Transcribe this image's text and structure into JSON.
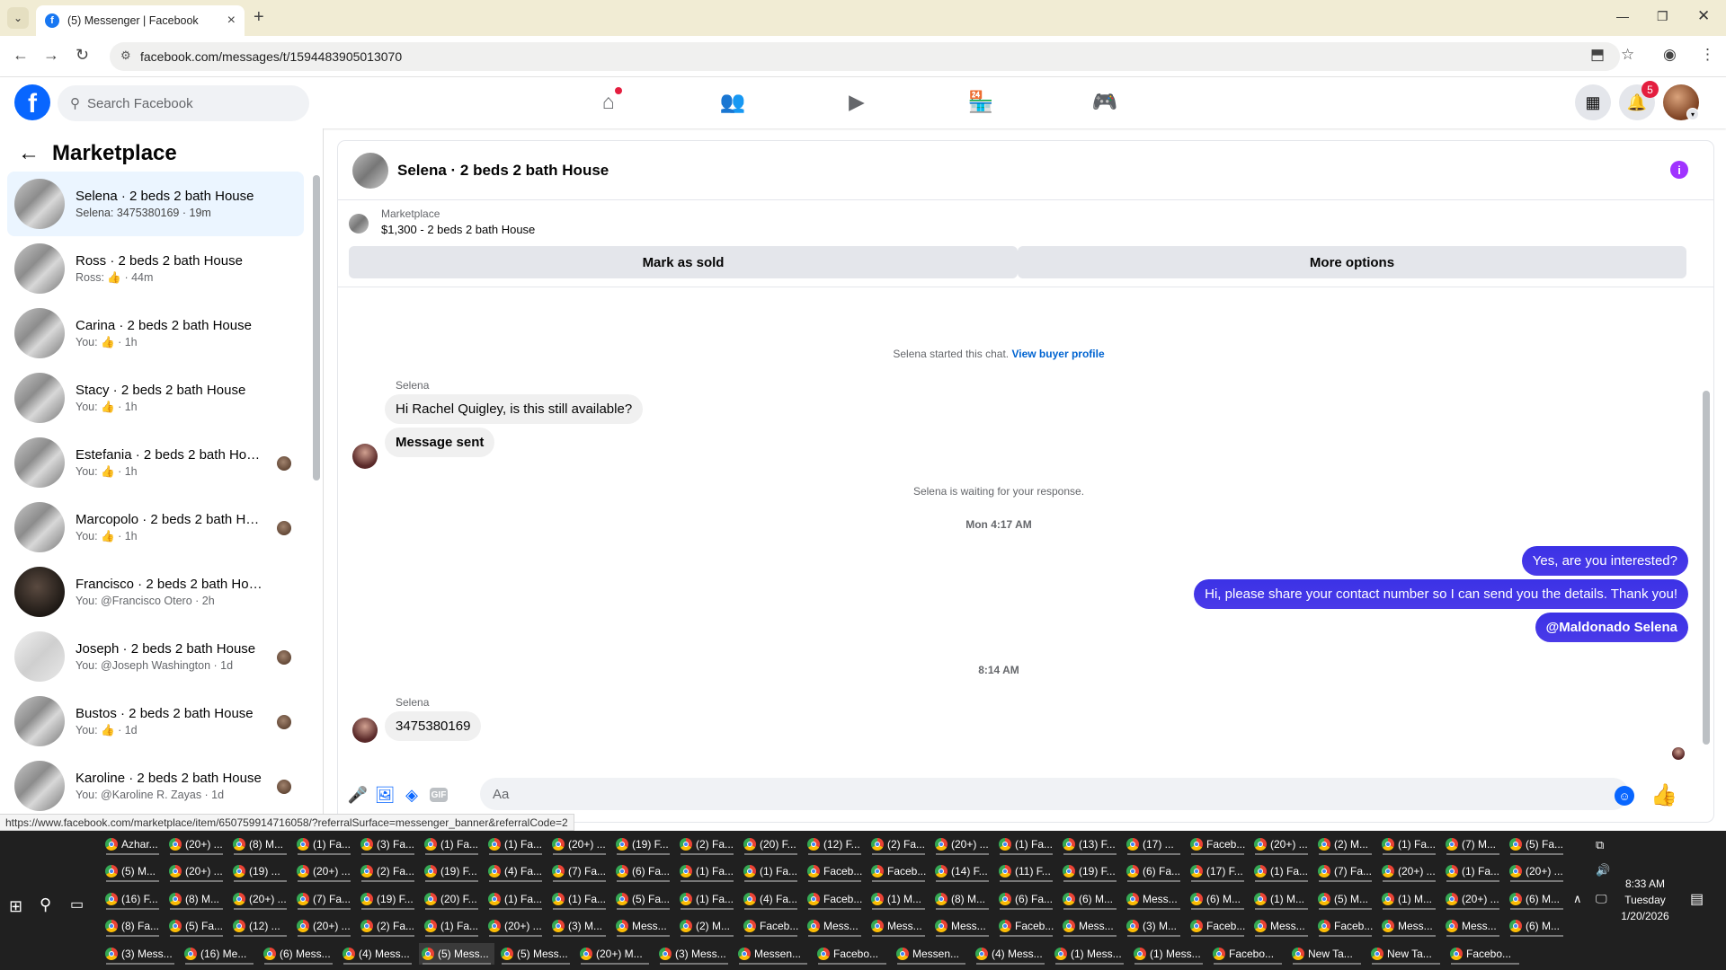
{
  "browser": {
    "tab_title": "(5) Messenger | Facebook",
    "url": "facebook.com/messages/t/1594483905013070",
    "status_url": "https://www.facebook.com/marketplace/item/650759914716058/?referralSurface=messenger_banner&referralCode=2"
  },
  "fb_header": {
    "search_placeholder": "Search Facebook",
    "notification_count": "5",
    "nav_icons": [
      "home-icon",
      "friends-icon",
      "watch-icon",
      "marketplace-icon",
      "gaming-icon"
    ]
  },
  "sidebar": {
    "title": "Marketplace",
    "conversations": [
      {
        "name": "Selena · 2 beds 2 bath House",
        "preview": "Selena: 3475380169 · 19m"
      },
      {
        "name": "Ross · 2 beds 2 bath House",
        "preview": "Ross: 👍 · 44m"
      },
      {
        "name": "Carina · 2 beds 2 bath House",
        "preview": "You: 👍 · 1h"
      },
      {
        "name": "Stacy · 2 beds 2 bath House",
        "preview": "You: 👍 · 1h"
      },
      {
        "name": "Estefania · 2 beds 2 bath House",
        "preview": "You: 👍 · 1h"
      },
      {
        "name": "Marcopolo · 2 beds 2 bath Ho...",
        "preview": "You: 👍 · 1h"
      },
      {
        "name": "Francisco · 2 beds 2 bath House",
        "preview": "You: @Francisco Otero · 2h"
      },
      {
        "name": "Joseph · 2 beds 2 bath House",
        "preview": "You: @Joseph Washington · 1d"
      },
      {
        "name": "Bustos · 2 beds 2 bath House",
        "preview": "You: 👍 · 1d"
      },
      {
        "name": "Karoline · 2 beds 2 bath House",
        "preview": "You: @Karoline R. Zayas · 1d"
      }
    ]
  },
  "chat": {
    "title": "Selena · 2 beds 2 bath House",
    "banner_label": "Marketplace",
    "banner_price": "$1,300 - 2 beds 2 bath House",
    "mark_sold": "Mark as sold",
    "more_options": "More options",
    "started_text": "Selena started this chat.",
    "view_profile": "View buyer profile",
    "sender_name": "Selena",
    "msg_in_1": "Hi Rachel Quigley, is this still available?",
    "msg_in_2": "Message sent",
    "waiting_text": "Selena is waiting for your response.",
    "time_1": "Mon 4:17 AM",
    "msg_out_1": "Yes, are you interested?",
    "msg_out_2": "Hi, please share your contact number so I can send you the details. Thank you!",
    "msg_out_3": "@Maldonado Selena",
    "time_2": "8:14 AM",
    "msg_in_3": "3475380169",
    "input_placeholder": "Aa"
  },
  "taskbar": {
    "rows": [
      [
        "Azhar...",
        "(20+) ...",
        "(8) M...",
        "(1) Fa...",
        "(3) Fa...",
        "(1) Fa...",
        "(1) Fa...",
        "(20+) ...",
        "(19) F...",
        "(2) Fa...",
        "(20) F...",
        "(12) F...",
        "(2) Fa...",
        "(20+) ...",
        "(1) Fa...",
        "(13) F...",
        "(17) ...",
        "Faceb...",
        "(20+) ...",
        "(2) M...",
        "(1) Fa...",
        "(7) M...",
        "(5) Fa..."
      ],
      [
        "(5) M...",
        "(20+) ...",
        "(19) ...",
        "(20+) ...",
        "(2) Fa...",
        "(19) F...",
        "(4) Fa...",
        "(7) Fa...",
        "(6) Fa...",
        "(1) Fa...",
        "(1) Fa...",
        "Faceb...",
        "Faceb...",
        "(14) F...",
        "(11) F...",
        "(19) F...",
        "(6) Fa...",
        "(17) F...",
        "(1) Fa...",
        "(7) Fa...",
        "(20+) ...",
        "(1) Fa...",
        "(20+) ..."
      ],
      [
        "(16) F...",
        "(8) M...",
        "(20+) ...",
        "(7) Fa...",
        "(19) F...",
        "(20) F...",
        "(1) Fa...",
        "(1) Fa...",
        "(5) Fa...",
        "(1) Fa...",
        "(4) Fa...",
        "Faceb...",
        "(1) M...",
        "(8) M...",
        "(6) Fa...",
        "(6) M...",
        "Mess...",
        "(6) M...",
        "(1) M...",
        "(5) M...",
        "(1) M...",
        "(20+) ...",
        "(6) M..."
      ],
      [
        "(8) Fa...",
        "(5) Fa...",
        "(12) ...",
        "(20+) ...",
        "(2) Fa...",
        "(1) Fa...",
        "(20+) ...",
        "(3) M...",
        "Mess...",
        "(2) M...",
        "Faceb...",
        "Mess...",
        "Mess...",
        "Mess...",
        "Faceb...",
        "Mess...",
        "(3) M...",
        "Faceb...",
        "Mess...",
        "Faceb...",
        "Mess...",
        "Mess...",
        "(6) M..."
      ],
      [
        "(3) Mess...",
        "(16) Me...",
        "(6) Mess...",
        "(4) Mess...",
        "(5) Mess...",
        "(5) Mess...",
        "(20+) M...",
        "(3) Mess...",
        "Messen...",
        "Facebo...",
        "Messen...",
        "(4) Mess...",
        "(1) Mess...",
        "(1) Mess...",
        "Facebo...",
        "New Ta...",
        "New Ta...",
        "Facebo..."
      ]
    ],
    "time": "8:33 AM",
    "day": "Tuesday",
    "date": "1/20/2026"
  }
}
